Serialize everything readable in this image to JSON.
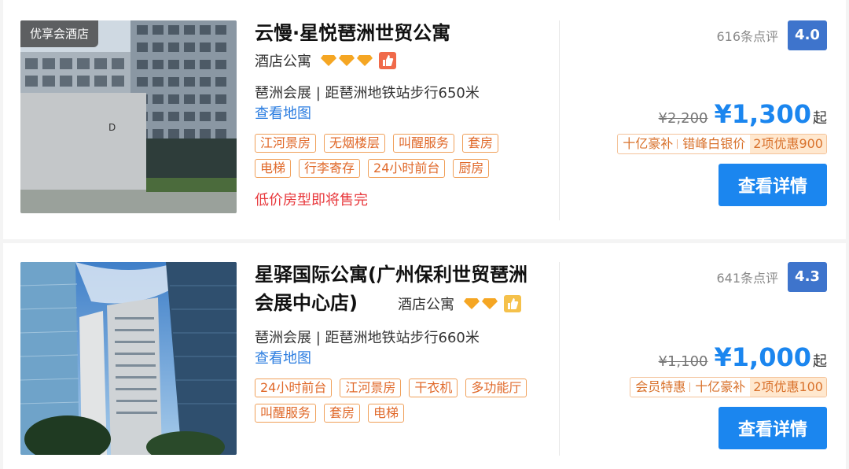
{
  "hotels": [
    {
      "badge": "优享会酒店",
      "name": "云慢·星悦琶洲世贸公寓",
      "type": "酒店公寓",
      "diamond_count": 3,
      "recommend_icon_color": "#f06a4a",
      "location": "琶洲会展 | 距琶洲地铁站步行650米",
      "map_link": "查看地图",
      "tags": [
        "江河景房",
        "无烟楼层",
        "叫醒服务",
        "套房",
        "电梯",
        "行李寄存",
        "24小时前台",
        "厨房"
      ],
      "warning": "低价房型即将售完",
      "reviews": "616条点评",
      "score": "4.0",
      "original_price": "¥2,200",
      "price": "¥1,300",
      "price_suffix": "起",
      "promos": [
        "十亿豪补",
        "错峰白银价"
      ],
      "discount": "2项优惠900",
      "button": "查看详情"
    },
    {
      "badge": "",
      "name": "星驿国际公寓(广州保利世贸琶洲会展中心店)",
      "type": "酒店公寓",
      "diamond_count": 2,
      "recommend_icon_color": "#f5c14b",
      "location": "琶洲会展 | 距琶洲地铁站步行660米",
      "map_link": "查看地图",
      "tags": [
        "24小时前台",
        "江河景房",
        "干衣机",
        "多功能厅",
        "叫醒服务",
        "套房",
        "电梯"
      ],
      "warning": "",
      "reviews": "641条点评",
      "score": "4.3",
      "original_price": "¥1,100",
      "price": "¥1,000",
      "price_suffix": "起",
      "promos": [
        "会员特惠",
        "十亿豪补"
      ],
      "discount": "2项优惠100",
      "button": "查看详情"
    }
  ],
  "colors": {
    "accent_blue": "#1b86ef",
    "score_blue": "#3e74cc",
    "tag_orange": "#e0692a",
    "warning_red": "#e8393d",
    "diamond_gold": "#f5a623"
  }
}
